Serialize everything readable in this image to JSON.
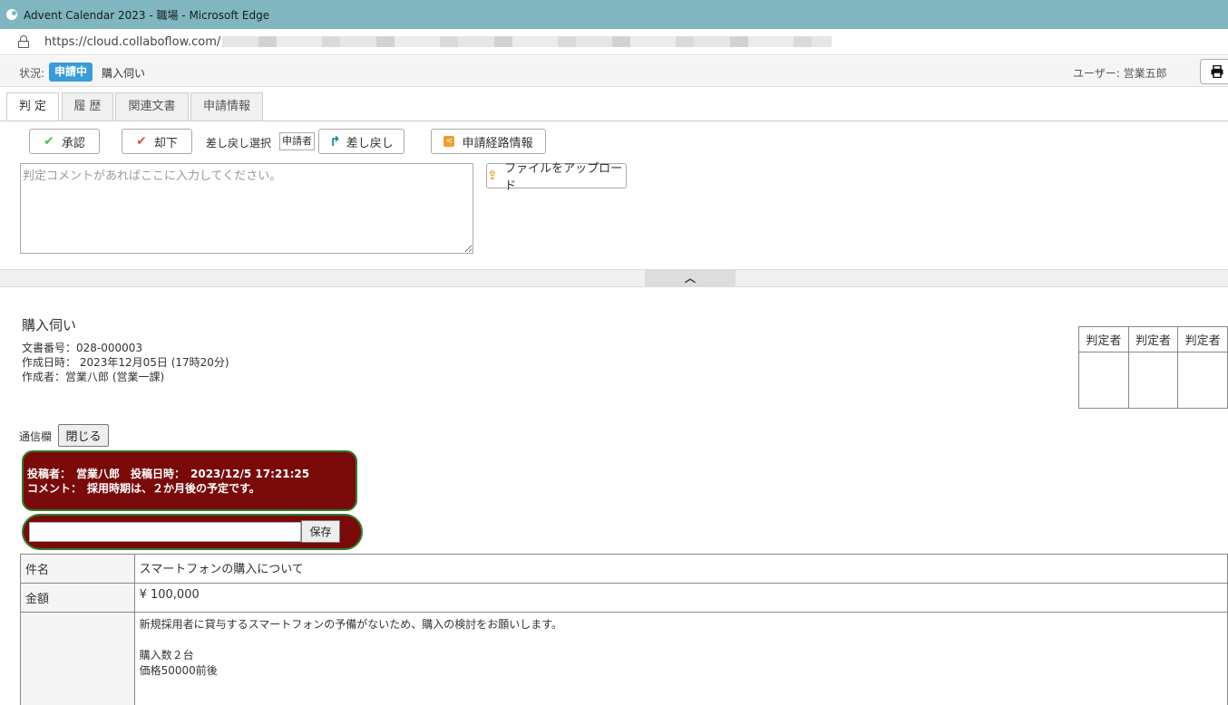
{
  "window": {
    "title": "Advent Calendar 2023 - 職場 - Microsoft Edge"
  },
  "address": {
    "url": "https://cloud.collaboflow.com/"
  },
  "status": {
    "label": "状況:",
    "badge": "申請中",
    "doc_name": "購入伺い",
    "user": "ユーザー: 営業五郎"
  },
  "tabs": [
    "判 定",
    "履 歴",
    "関連文書",
    "申請情報"
  ],
  "actions": {
    "approve": "承認",
    "reject": "却下",
    "sendback_select_label": "差し戻し選択",
    "sendback_target": "申請者",
    "sendback": "差し戻し",
    "route_info": "申請経路情報",
    "upload": "ファイルをアップロード",
    "comment_placeholder": "判定コメントがあればここに入力してください。"
  },
  "collapse": {
    "icon": "chevron-up-icon"
  },
  "document": {
    "title": "購入伺い",
    "number": "文書番号：028-000003",
    "created": "作成日時： 2023年12月05日 (17時20分)",
    "author": "作成者：営業八郎 (営業一課)"
  },
  "approvers": [
    "判定者",
    "判定者",
    "判定者"
  ],
  "board": {
    "label": "通信欄",
    "close": "閉じる",
    "post_line1": "投稿者：　営業八郎　投稿日時：　2023/12/5 17:21:25",
    "post_line2": "コメント：　採用時期は、２か月後の予定です。",
    "save": "保存"
  },
  "form": {
    "rows": [
      {
        "key": "件名",
        "value": "スマートフォンの購入について"
      },
      {
        "key": "金額",
        "value": "¥ 100,000"
      }
    ],
    "body_lines": [
      "新規採用者に貸与するスマートフォンの予備がないため、購入の検討をお願いします。",
      "",
      "購入数２台",
      "価格50000前後"
    ]
  }
}
